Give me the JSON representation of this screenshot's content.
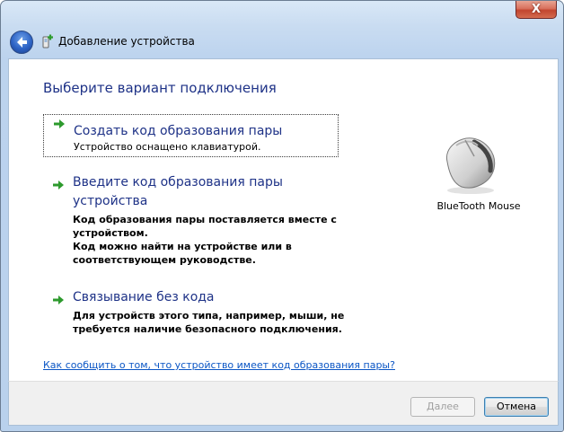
{
  "window": {
    "title": "Добавление устройства",
    "close_label": "X"
  },
  "main": {
    "heading": "Выберите вариант подключения",
    "options": [
      {
        "title": "Создать код образования пары",
        "description": [
          "Устройство оснащено клавиатурой."
        ],
        "selected": true
      },
      {
        "title": [
          "Введите код образования пары",
          "устройства"
        ],
        "description": [
          "Код образования пары поставляется вместе с",
          "устройством.",
          "Код можно найти на устройстве или в",
          "соответствующем руководстве."
        ]
      },
      {
        "title": "Связывание без кода",
        "description": [
          "Для устройств этого типа, например, мыши, не",
          "требуется наличие безопасного подключения."
        ]
      }
    ],
    "device": {
      "name": "BlueTooth Mouse",
      "icon": "mouse-icon"
    },
    "help_link": "Как сообщить о том, что устройство имеет код образования пары?"
  },
  "footer": {
    "next_label": "Далее",
    "next_enabled": false,
    "cancel_label": "Отмена"
  },
  "colors": {
    "heading": "#1e3287",
    "link": "#0b56c5",
    "arrow": "#2d9a2d"
  }
}
